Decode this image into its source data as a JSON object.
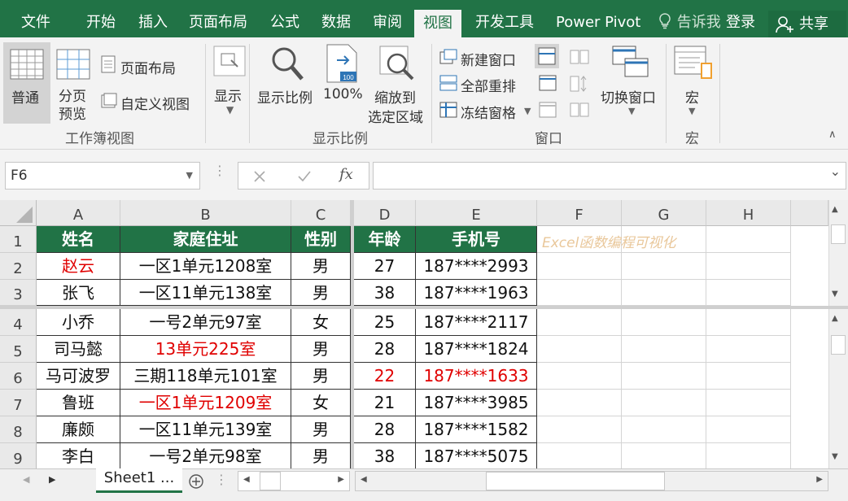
{
  "ribbon_tabs": [
    "文件",
    "开始",
    "插入",
    "页面布局",
    "公式",
    "数据",
    "审阅",
    "视图",
    "开发工具",
    "Power Pivot"
  ],
  "active_tab": "视图",
  "tell_me": "告诉我",
  "login": "登录",
  "share": "共享",
  "ribbon": {
    "normal": "普通",
    "page_break_1": "分页",
    "page_break_2": "预览",
    "page_layout": "页面布局",
    "custom_view": "自定义视图",
    "group_workbook_views": "工作簿视图",
    "show": "显示",
    "zoom": "显示比例",
    "zoom_100": "100%",
    "zoom_sel_1": "缩放到",
    "zoom_sel_2": "选定区域",
    "group_zoom": "显示比例",
    "new_window": "新建窗口",
    "arrange_all": "全部重排",
    "freeze_panes": "冻结窗格",
    "switch_windows": "切换窗口",
    "group_window": "窗口",
    "macros": "宏",
    "group_macros": "宏"
  },
  "formula_bar": {
    "name_box": "F6",
    "fx": "fx",
    "formula": ""
  },
  "columns": [
    "A",
    "B",
    "C",
    "D",
    "E",
    "F",
    "G",
    "H"
  ],
  "row_numbers": [
    "1",
    "2",
    "3",
    "4",
    "5",
    "6",
    "7",
    "8",
    "9"
  ],
  "header_row": [
    "姓名",
    "家庭住址",
    "性别",
    "年龄",
    "手机号"
  ],
  "watermark": "Excel函数编程可视化",
  "rows": [
    [
      "赵云",
      "一区1单元1208室",
      "男",
      "27",
      "187****2993"
    ],
    [
      "张飞",
      "一区11单元138室",
      "男",
      "38",
      "187****1963"
    ],
    [
      "小乔",
      "一号2单元97室",
      "女",
      "25",
      "187****2117"
    ],
    [
      "司马懿",
      "13单元225室",
      "男",
      "28",
      "187****1824"
    ],
    [
      "马可波罗",
      "三期118单元101室",
      "男",
      "22",
      "187****1633"
    ],
    [
      "鲁班",
      "一区1单元1209室",
      "女",
      "21",
      "187****3985"
    ],
    [
      "廉颇",
      "一区11单元139室",
      "男",
      "28",
      "187****1582"
    ],
    [
      "李白",
      "一号2单元98室",
      "男",
      "38",
      "187****5075"
    ]
  ],
  "red_cells": [
    "0-0",
    "3-1",
    "4-3",
    "4-4",
    "5-1"
  ],
  "sheet_tab": "Sheet1 ...",
  "colors": {
    "accent": "#217346",
    "red": "#e00000"
  }
}
